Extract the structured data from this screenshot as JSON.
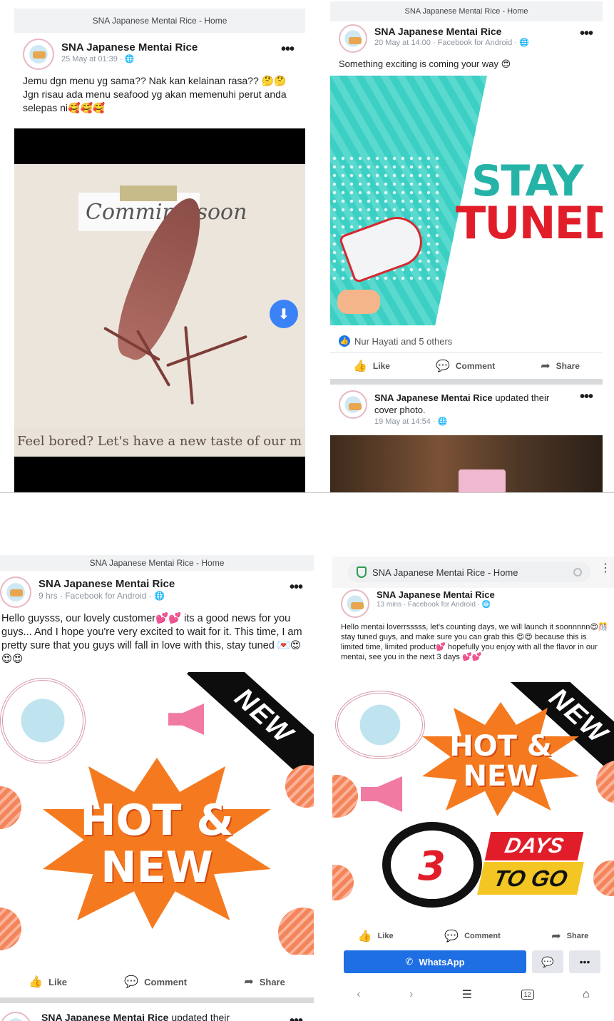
{
  "panel1": {
    "browser_title": "SNA Japanese Mentai Rice - Home",
    "post": {
      "page_name": "SNA Japanese Mentai Rice",
      "time": "25 May at 01:39 · ",
      "text": "Jemu dgn menu yg sama?? Nak kan kelainan rasa?? 🤔🤔 Jgn risau ada menu seafood yg akan memenuhi perut anda selepas ni🥰🥰🥰",
      "image_script": "Comming soon",
      "image_caption": "Feel bored? Let's have a new taste of our m"
    }
  },
  "panel2": {
    "browser_title": "SNA Japanese Mentai Rice - Home",
    "post": {
      "page_name": "SNA Japanese Mentai Rice",
      "time": "20 May at 14:00 · Facebook for Android · ",
      "text": "Something exciting is coming your way 😍",
      "image_line1": "STAY",
      "image_line2": "TUNED",
      "reactions": "Nur Hayati and 5 others",
      "like": "Like",
      "comment": "Comment",
      "share": "Share"
    },
    "next_post": {
      "page_name": "SNA Japanese Mentai Rice",
      "action": " updated their cover photo.",
      "time": "19 May at 14:54 · "
    }
  },
  "panel3": {
    "browser_title": "SNA Japanese Mentai Rice - Home",
    "post": {
      "page_name": "SNA Japanese Mentai Rice",
      "time": "9 hrs · Facebook for Android · ",
      "text": "Hello guysss, our lovely customer💕💕 its a good news for you guys... And I hope you're very excited to wait for it. This time, I am pretty sure that you guys will fall in love with this, stay tuned 💌😍😍😍",
      "ribbon": "NEW",
      "hot": "HOT &",
      "new": "NEW",
      "like": "Like",
      "comment": "Comment",
      "share": "Share"
    },
    "next_post": {
      "page_name": "SNA Japanese Mentai Rice",
      "action": " updated their"
    }
  },
  "panel4": {
    "browser_title": "SNA Japanese Mentai Rice - Home",
    "post": {
      "page_name": "SNA Japanese Mentai Rice",
      "time": "13 mins · Facebook for Android · ",
      "text": "Hello mentai loverrsssss, let's counting days, we will launch it soonnnnn😍🎊 stay tuned guys, and make sure you can grab this 😍😍 because this is limited time, limited product💕 hopefully you enjoy with all the flavor in our mentai, see you in the next 3 days 💕💕",
      "ribbon": "NEW",
      "hot": "HOT &",
      "new": "NEW",
      "countdown_number": "3",
      "days": "DAYS",
      "to_go": "TO GO",
      "like": "Like",
      "comment": "Comment",
      "share": "Share",
      "whatsapp": "WhatsApp",
      "tab_count": "12"
    }
  },
  "colors": {
    "facebook_blue": "#1877f2",
    "whatsapp_button": "#1e6fe3",
    "stay_teal": "#26b3a7",
    "tuned_red": "#e11d2a",
    "burst_orange": "#f57a1f"
  }
}
